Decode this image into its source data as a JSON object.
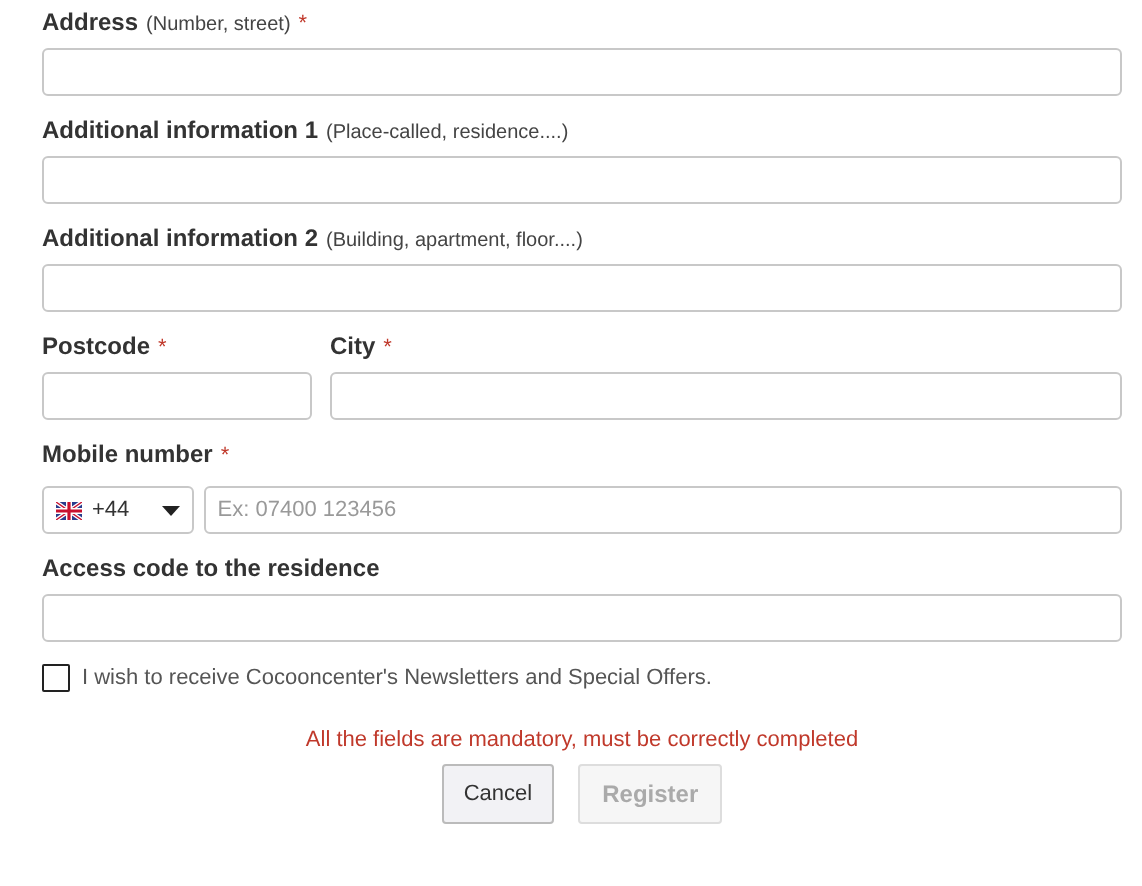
{
  "rows": [
    [
      {
        "kind": "text",
        "label": "Address",
        "hint": "(Number, street)",
        "required_mark": "*"
      }
    ],
    [
      {
        "kind": "text",
        "label": "Additional information 1",
        "hint": "(Place-called, residence....)"
      }
    ],
    [
      {
        "kind": "text",
        "label": "Additional information 2",
        "hint": "(Building, apartment, floor....)"
      }
    ],
    [
      {
        "kind": "text",
        "label": "Postcode",
        "required_mark": "*"
      },
      {
        "kind": "text",
        "label": "City",
        "required_mark": "*"
      }
    ],
    [
      {
        "kind": "phone",
        "label": "Mobile number",
        "required_mark": "*",
        "country_code": "+44",
        "placeholder": "Ex: 07400 123456"
      }
    ],
    [
      {
        "kind": "text",
        "label": "Access code to the residence"
      }
    ]
  ],
  "newsletter": {
    "label": "I wish to receive Cocooncenter's Newsletters and Special Offers.",
    "checked": false
  },
  "notice": "All the fields are mandatory, must be correctly completed",
  "buttons": [
    {
      "label": "Cancel",
      "disabled": false
    },
    {
      "label": "Register",
      "disabled": true
    }
  ]
}
